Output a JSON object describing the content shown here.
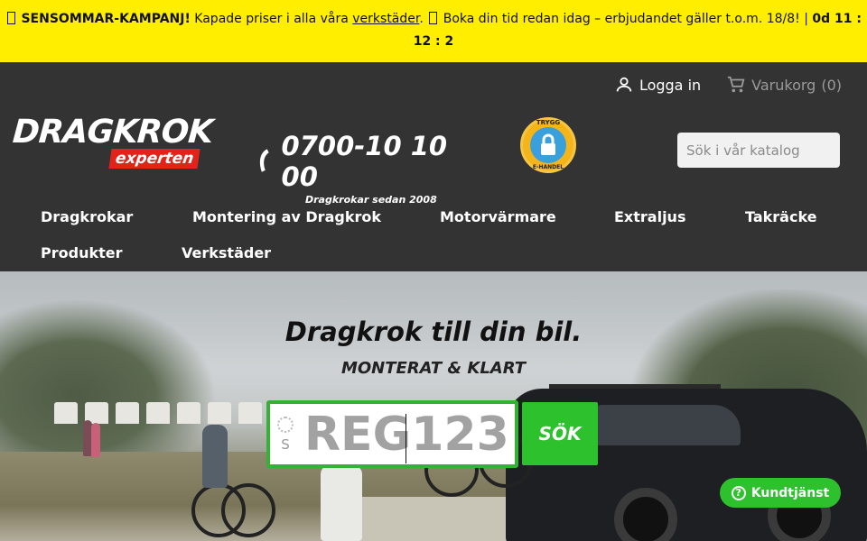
{
  "promo": {
    "title": "SENSOMMAR-KAMPANJ!",
    "text1": "Kapade priser i alla våra",
    "link": "verkstäder",
    "text2": ". ",
    "text3": "Boka din tid redan idag – erbjudandet gäller t.o.m. 18/8! |",
    "countdown": "0d 11 : 12 : 2"
  },
  "header": {
    "login_label": "Logga in",
    "cart_label": "Varukorg",
    "cart_count": "(0)",
    "logo_main": "DRAGKROK",
    "logo_sub": "experten",
    "phone": "0700-10 10 00",
    "phone_sub": "Dragkrokar sedan 2008",
    "trust_top": "TRYGG",
    "trust_bottom": "E-HANDEL",
    "search_placeholder": "Sök i vår katalog"
  },
  "nav": {
    "items": [
      "Dragkrokar",
      "Montering av Dragkrok",
      "Motorvärmare",
      "Extraljus",
      "Takräcke",
      "Produkter",
      "Verkstäder"
    ]
  },
  "hero": {
    "title": "Dragkrok till din bil.",
    "subtitle": "MONTERAT & KLART",
    "plate_country": "S",
    "plate_placeholder": "REG123",
    "search_button": "SÖK"
  },
  "support": {
    "label": "Kundtjänst"
  },
  "colors": {
    "promo_bg": "#ffee00",
    "header_bg": "#333333",
    "accent_green": "#2dc12d",
    "logo_red": "#e2231a"
  }
}
